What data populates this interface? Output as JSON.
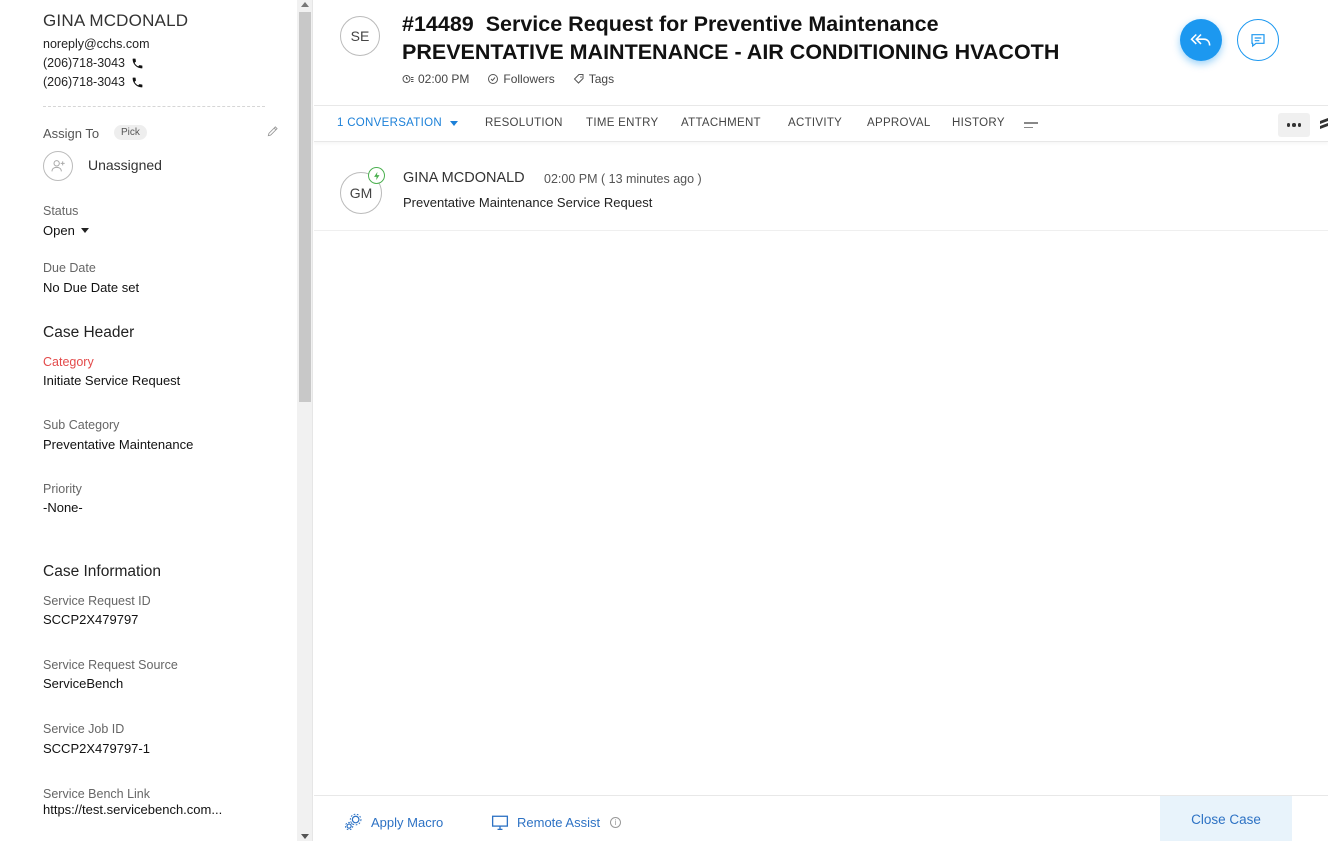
{
  "contact": {
    "name": "GINA MCDONALD",
    "email": "noreply@cchs.com",
    "phones": [
      "(206)718-3043",
      "(206)718-3043"
    ]
  },
  "assign": {
    "label": "Assign To",
    "pick_label": "Pick",
    "assignee": "Unassigned"
  },
  "status": {
    "label": "Status",
    "value": "Open"
  },
  "due_date": {
    "label": "Due Date",
    "value": "No Due Date set"
  },
  "case_header": {
    "title": "Case Header",
    "category_label": "Category",
    "category_value": "Initiate Service Request",
    "sub_category_label": "Sub Category",
    "sub_category_value": "Preventative Maintenance",
    "priority_label": "Priority",
    "priority_value": "-None-"
  },
  "case_info": {
    "title": "Case Information",
    "sr_id_label": "Service Request ID",
    "sr_id_value": "SCCP2X479797",
    "sr_source_label": "Service Request Source",
    "sr_source_value": "ServiceBench",
    "job_id_label": "Service Job ID",
    "job_id_value": "SCCP2X479797-1",
    "link_label": "Service Bench Link",
    "link_value": "https://test.servicebench.com..."
  },
  "ticket": {
    "avatar_initials": "SE",
    "title_line1": "#14489  Service Request for Preventive Maintenance",
    "title_line2": "PREVENTATIVE MAINTENANCE - AIR CONDITIONING HVACOTH",
    "time": "02:00 PM",
    "followers": "Followers",
    "tags": "Tags"
  },
  "tabs": [
    "1 CONVERSATION",
    "RESOLUTION",
    "TIME ENTRY",
    "ATTACHMENT",
    "ACTIVITY",
    "APPROVAL",
    "HISTORY"
  ],
  "conversation": {
    "initials": "GM",
    "name": "GINA MCDONALD",
    "time": "02:00 PM ( 13 minutes ago )",
    "body": "Preventative Maintenance Service Request"
  },
  "bottom": {
    "apply_macro": "Apply Macro",
    "remote_assist": "Remote Assist",
    "close_case": "Close Case"
  },
  "colors": {
    "accent": "#1c98f0",
    "link": "#2d72c4",
    "required_label": "#e34b4b",
    "ai_badge": "#4cb050"
  }
}
